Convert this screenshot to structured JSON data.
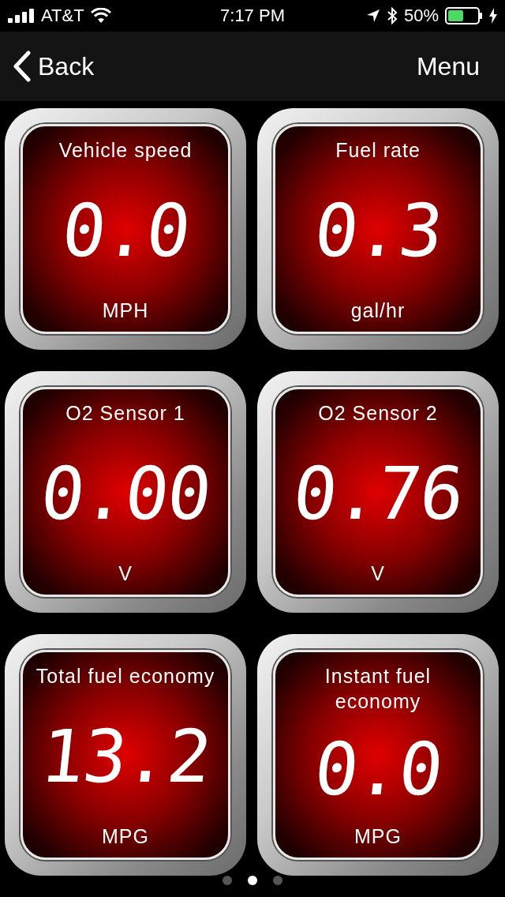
{
  "status_bar": {
    "carrier": "AT&T",
    "time": "7:17 PM",
    "battery": "50%"
  },
  "nav": {
    "back": "Back",
    "menu": "Menu"
  },
  "gauges": [
    {
      "label": "Vehicle speed",
      "value": "0.0",
      "unit": "MPH"
    },
    {
      "label": "Fuel rate",
      "value": "0.3",
      "unit": "gal/hr"
    },
    {
      "label": "O2 Sensor 1",
      "value": "0.00",
      "unit": "V"
    },
    {
      "label": "O2 Sensor 2",
      "value": "0.76",
      "unit": "V"
    },
    {
      "label": "Total fuel economy",
      "value": "13.2",
      "unit": "MPG"
    },
    {
      "label": "Instant fuel economy",
      "value": "0.0",
      "unit": "MPG"
    }
  ],
  "pages": [
    {
      "selected": false
    },
    {
      "selected": true
    },
    {
      "selected": false
    }
  ]
}
